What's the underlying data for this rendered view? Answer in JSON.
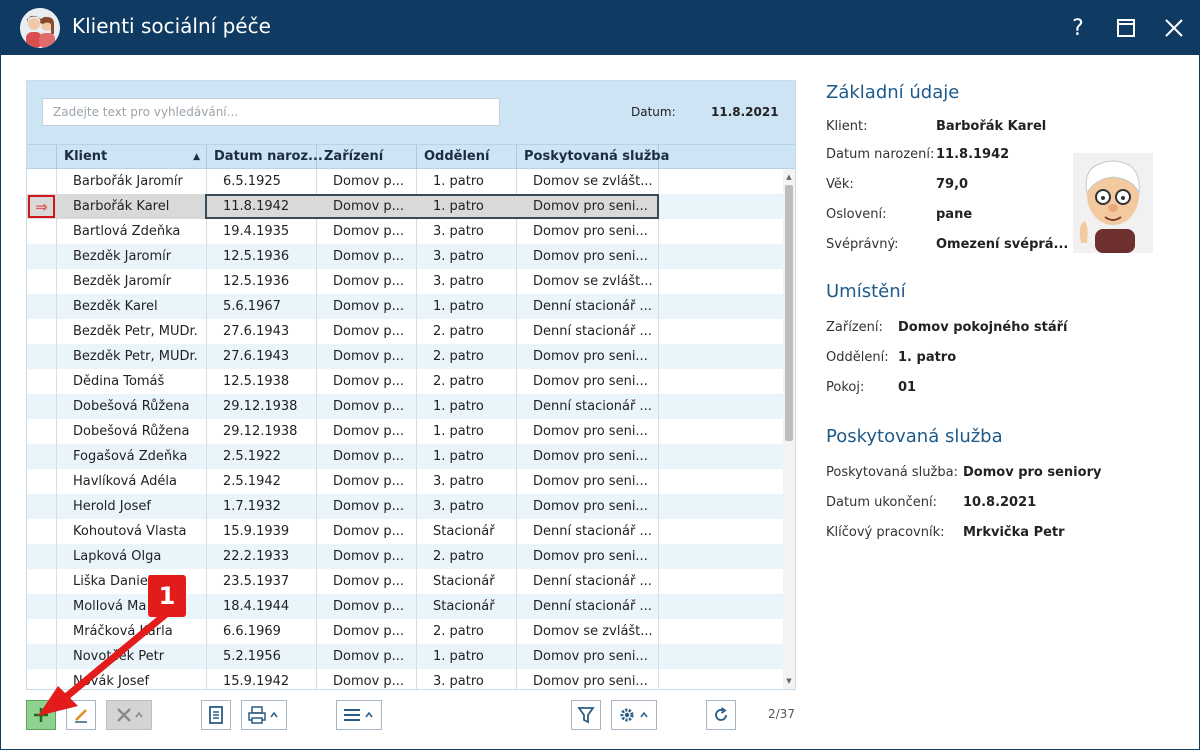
{
  "window": {
    "title": "Klienti sociální péče",
    "help": "?",
    "maximize": "□",
    "close": "✕"
  },
  "search": {
    "placeholder": "Zadejte text pro vyhledávání...",
    "value": ""
  },
  "date": {
    "label": "Datum:",
    "value": "11.8.2021"
  },
  "columns": [
    "Klient",
    "Datum naroz...",
    "Zařízení",
    "Oddělení",
    "Poskytovaná služba"
  ],
  "rows": [
    [
      "Barbořák Jaromír",
      "6.5.1925",
      "Domov p...",
      "1. patro",
      "Domov se zvlášt..."
    ],
    [
      "Barbořák Karel",
      "11.8.1942",
      "Domov p...",
      "1. patro",
      "Domov pro seni..."
    ],
    [
      "Bartlová Zdeňka",
      "19.4.1935",
      "Domov p...",
      "3. patro",
      "Domov pro seni..."
    ],
    [
      "Bezděk Jaromír",
      "12.5.1936",
      "Domov p...",
      "3. patro",
      "Domov pro seni..."
    ],
    [
      "Bezděk Jaromír",
      "12.5.1936",
      "Domov p...",
      "3. patro",
      "Domov se zvlášt..."
    ],
    [
      "Bezděk Karel",
      "5.6.1967",
      "Domov p...",
      "1. patro",
      "Denní stacionář ..."
    ],
    [
      "Bezděk Petr, MUDr.",
      "27.6.1943",
      "Domov p...",
      "2. patro",
      "Denní stacionář ..."
    ],
    [
      "Bezděk Petr, MUDr.",
      "27.6.1943",
      "Domov p...",
      "2. patro",
      "Domov pro seni..."
    ],
    [
      "Dědina Tomáš",
      "12.5.1938",
      "Domov p...",
      "2. patro",
      "Domov pro seni..."
    ],
    [
      "Dobešová Růžena",
      "29.12.1938",
      "Domov p...",
      "1. patro",
      "Denní stacionář ..."
    ],
    [
      "Dobešová Růžena",
      "29.12.1938",
      "Domov p...",
      "1. patro",
      "Domov pro seni..."
    ],
    [
      "Fogašová Zdeňka",
      "2.5.1922",
      "Domov p...",
      "1. patro",
      "Domov pro seni..."
    ],
    [
      "Havlíková Adéla",
      "2.5.1942",
      "Domov p...",
      "3. patro",
      "Domov pro seni..."
    ],
    [
      "Herold Josef",
      "1.7.1932",
      "Domov p...",
      "3. patro",
      "Domov pro seni..."
    ],
    [
      "Kohoutová Vlasta",
      "15.9.1939",
      "Domov p...",
      "Stacionář",
      "Denní stacionář ..."
    ],
    [
      "Lapková Olga",
      "22.2.1933",
      "Domov p...",
      "2. patro",
      "Domov pro seni..."
    ],
    [
      "Liška Daniel",
      "23.5.1937",
      "Domov p...",
      "Stacionář",
      "Denní stacionář ..."
    ],
    [
      "Mollová Ma",
      "18.4.1944",
      "Domov p...",
      "Stacionář",
      "Denní stacionář ..."
    ],
    [
      "Mráčková Karla",
      "6.6.1969",
      "Domov p...",
      "2. patro",
      "Domov se zvlášt..."
    ],
    [
      "Novotček Petr",
      "5.2.1956",
      "Domov p...",
      "1. patro",
      "Domov pro seni..."
    ],
    [
      "Novák Josef",
      "15.9.1942",
      "Domov p...",
      "3. patro",
      "Domov pro seni..."
    ]
  ],
  "selected_row_index": 1,
  "pager": {
    "text": "2/37"
  },
  "annotation": {
    "badge": "1"
  },
  "detail": {
    "basic": {
      "title": "Základní údaje",
      "client_label": "Klient:",
      "client_value": "Barbořák Karel",
      "birth_label": "Datum narození:",
      "birth_value": "11.8.1942",
      "age_label": "Věk:",
      "age_value": "79,0",
      "salutation_label": "Oslovení:",
      "salutation_value": "pane",
      "legal_label": "Svéprávný:",
      "legal_value": "Omezení svéprá..."
    },
    "placement": {
      "title": "Umístění",
      "facility_label": "Zařízení:",
      "facility_value": "Domov pokojného stáří",
      "department_label": "Oddělení:",
      "department_value": "1. patro",
      "room_label": "Pokoj:",
      "room_value": "01"
    },
    "service": {
      "title": "Poskytovaná služba",
      "service_label": "Poskytovaná služba:",
      "service_value": "Domov pro seniory",
      "end_label": "Datum ukončení:",
      "end_value": "10.8.2021",
      "worker_label": "Klíčový pracovník:",
      "worker_value": "Mrkvička Petr"
    }
  },
  "colors": {
    "titlebar": "#0f3b63",
    "grid_header": "#cce4f4",
    "alt_row": "#e9f4fb",
    "section_title": "#1e5a8a",
    "annotation_red": "#e21b1b",
    "add_button": "#8fd18f"
  }
}
